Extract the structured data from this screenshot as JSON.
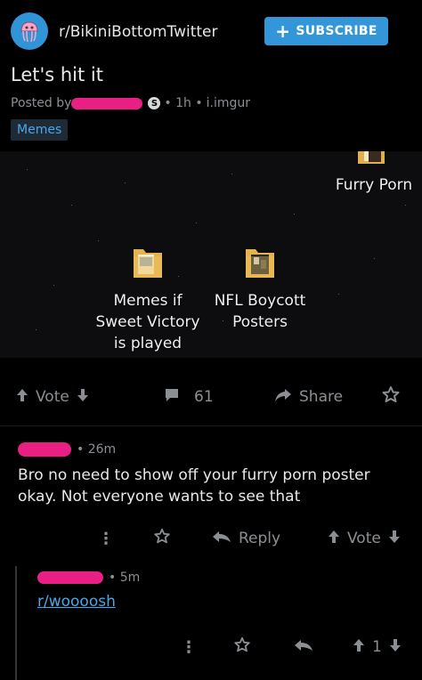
{
  "header": {
    "subreddit": "r/BikiniBottomTwitter",
    "subscribe_label": "SUBSCRIBE"
  },
  "post": {
    "title": "Let's hit it",
    "posted_by_label": "Posted by",
    "badge_letter": "S",
    "age": "• 1h •",
    "domain": "i.imgur",
    "flair": "Memes",
    "image": {
      "folders": [
        {
          "label": "Furry Porn"
        },
        {
          "label_lines": [
            "Memes if",
            "Sweet Victory",
            "is played"
          ]
        },
        {
          "label_lines": [
            "NFL Boycott",
            "Posters"
          ]
        }
      ]
    },
    "actions": {
      "vote_label": "Vote",
      "comment_count": "61",
      "share_label": "Share"
    }
  },
  "comments": [
    {
      "age": "• 26m",
      "body": "Bro no need to show off your furry porn poster okay. Not everyone wants to see that",
      "reply_label": "Reply",
      "vote_label": "Vote"
    },
    {
      "age": "• 5m",
      "link_text": "r/woooosh",
      "vote_count": "1"
    }
  ],
  "colors": {
    "background": "#000000",
    "accent_blue": "#3296d9",
    "redaction_pink": "#ea1f83",
    "link_blue": "#4aa7e8",
    "muted_text": "#8b8f93"
  },
  "icons": [
    "jellyfish-avatar-icon",
    "plus-icon",
    "upvote-icon",
    "downvote-icon",
    "comment-icon",
    "share-icon",
    "award-icon",
    "more-vertical-icon",
    "reply-icon",
    "folder-icon"
  ]
}
